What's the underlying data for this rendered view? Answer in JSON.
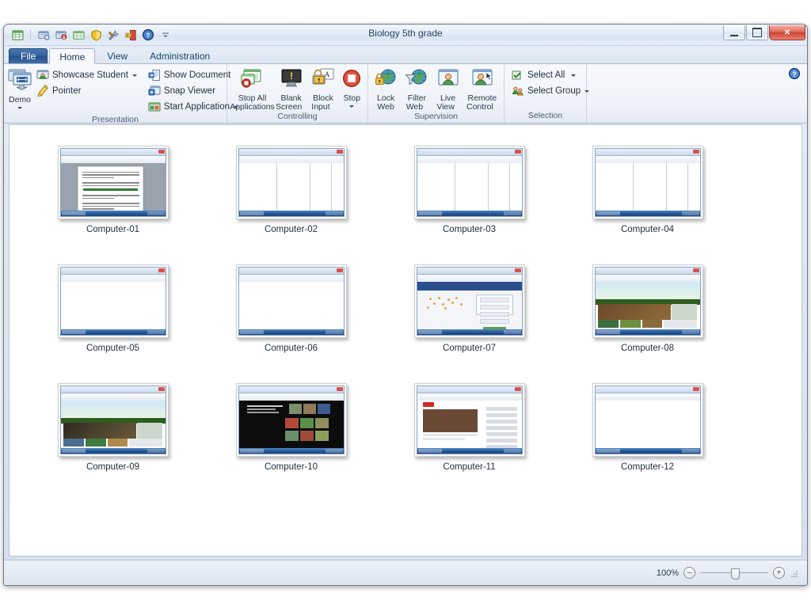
{
  "window": {
    "title": "Biology 5th grade",
    "controls": {
      "minimize": "minimize-button",
      "maximize": "maximize-button",
      "close": "✕"
    }
  },
  "quick_access": {
    "items": [
      {
        "name": "app-menu-icon",
        "glyph": "grid"
      },
      {
        "name": "classroom-icon",
        "glyph": "classroom"
      },
      {
        "name": "students-icon",
        "glyph": "students"
      },
      {
        "name": "list-icon",
        "glyph": "list"
      },
      {
        "name": "shield-icon",
        "glyph": "shield"
      },
      {
        "name": "tools-icon",
        "glyph": "tools"
      },
      {
        "name": "exit-icon",
        "glyph": "exit"
      },
      {
        "name": "help-icon",
        "glyph": "help"
      },
      {
        "name": "customize-qat-icon",
        "glyph": "caret"
      }
    ]
  },
  "tabs": [
    {
      "label": "File",
      "id": "file",
      "active": false
    },
    {
      "label": "Home",
      "id": "home",
      "active": true
    },
    {
      "label": "View",
      "id": "view",
      "active": false
    },
    {
      "label": "Administration",
      "id": "administration",
      "active": false
    }
  ],
  "ribbon": {
    "help_button": "?",
    "groups": [
      {
        "name": "presentation",
        "label": "Presentation",
        "big_buttons": [
          {
            "label": "Demo",
            "has_dropdown": true,
            "icon": "demo-icon"
          }
        ],
        "small_buttons_col1": [
          {
            "label": "Showcase Student",
            "has_dropdown": true,
            "icon": "showcase-student-icon"
          },
          {
            "label": "Pointer",
            "has_dropdown": false,
            "icon": "pointer-icon"
          }
        ],
        "small_buttons_col2": [
          {
            "label": "Show Document",
            "has_dropdown": false,
            "icon": "show-document-icon"
          },
          {
            "label": "Snap Viewer",
            "has_dropdown": false,
            "icon": "snap-viewer-icon"
          },
          {
            "label": "Start Application",
            "has_dropdown": true,
            "icon": "start-application-icon"
          }
        ]
      },
      {
        "name": "controlling",
        "label": "Controlling",
        "big_buttons": [
          {
            "label": "Stop All\nApplications",
            "line1": "Stop All",
            "line2": "Applications",
            "has_dropdown": false,
            "icon": "stop-all-applications-icon"
          },
          {
            "label": "Blank Screen",
            "line1": "Blank",
            "line2": "Screen",
            "has_dropdown": true,
            "icon": "blank-screen-icon"
          },
          {
            "label": "Block Input",
            "line1": "Block",
            "line2": "Input",
            "has_dropdown": true,
            "icon": "block-input-icon"
          },
          {
            "label": "Stop",
            "line1": "Stop",
            "line2": "",
            "has_dropdown": true,
            "icon": "stop-icon"
          }
        ]
      },
      {
        "name": "supervision",
        "label": "Supervision",
        "big_buttons": [
          {
            "label": "Lock Web",
            "line1": "Lock",
            "line2": "Web",
            "has_dropdown": false,
            "icon": "lock-web-icon"
          },
          {
            "label": "Filter Web",
            "line1": "Filter",
            "line2": "Web",
            "has_dropdown": true,
            "icon": "filter-web-icon"
          },
          {
            "label": "Live View",
            "line1": "Live",
            "line2": "View",
            "has_dropdown": true,
            "icon": "live-view-icon"
          },
          {
            "label": "Remote Control",
            "line1": "Remote",
            "line2": "Control",
            "has_dropdown": true,
            "icon": "remote-control-icon"
          }
        ]
      },
      {
        "name": "selection",
        "label": "Selection",
        "small_buttons_col1": [
          {
            "label": "Select All",
            "has_dropdown": true,
            "icon": "select-all-icon"
          },
          {
            "label": "Select Group",
            "has_dropdown": true,
            "icon": "select-group-icon"
          }
        ]
      }
    ]
  },
  "thumbnails": [
    {
      "label": "Computer-01",
      "screen": "word-document"
    },
    {
      "label": "Computer-02",
      "screen": "spreadsheet"
    },
    {
      "label": "Computer-03",
      "screen": "spreadsheet"
    },
    {
      "label": "Computer-04",
      "screen": "spreadsheet"
    },
    {
      "label": "Computer-05",
      "screen": "news-website"
    },
    {
      "label": "Computer-06",
      "screen": "news-website"
    },
    {
      "label": "Computer-07",
      "screen": "web-form"
    },
    {
      "label": "Computer-08",
      "screen": "nature-website"
    },
    {
      "label": "Computer-09",
      "screen": "nature-website"
    },
    {
      "label": "Computer-10",
      "screen": "dark-video-gallery"
    },
    {
      "label": "Computer-11",
      "screen": "video-player"
    },
    {
      "label": "Computer-12",
      "screen": "news-website"
    }
  ],
  "statusbar": {
    "zoom_level": "100%",
    "zoom_out_label": "–",
    "zoom_in_label": "+"
  },
  "colors": {
    "accent": "#2e5c96",
    "titlebar": "#dfe7f2",
    "close_button": "#cf4334",
    "workarea": "#ffffff"
  }
}
